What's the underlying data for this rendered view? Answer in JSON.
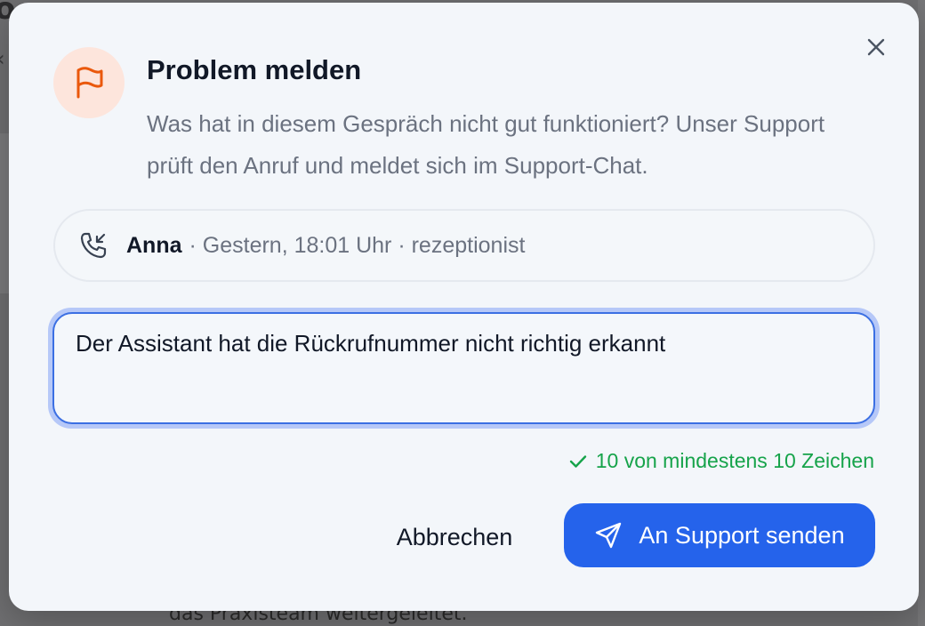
{
  "background": {
    "fragment_top": "o",
    "fragment_bottom": "das Praxisteam weitergeleitet."
  },
  "dialog": {
    "title": "Problem melden",
    "description": "Was hat in diesem Gespräch nicht gut funktioniert? Unser Support prüft den Anruf und meldet sich im Support-Chat.",
    "icons": {
      "header": "flag-icon",
      "close": "close-icon"
    },
    "colors": {
      "accent": "#2563eb",
      "flag": "#ea580c",
      "flag_bg": "#fde5dc",
      "success": "#16a34a"
    }
  },
  "call": {
    "icon": "incoming-call-icon",
    "name": "Anna",
    "meta": "· Gestern, 18:01 Uhr · rezeptionist"
  },
  "report": {
    "value": "Der Assistant hat die Rückrufnummer nicht richtig erkannt",
    "counter": "10 von mindestens 10 Zeichen",
    "counter_icon": "check-icon"
  },
  "actions": {
    "cancel_label": "Abbrechen",
    "send_label": "An Support senden",
    "send_icon": "send-icon"
  }
}
